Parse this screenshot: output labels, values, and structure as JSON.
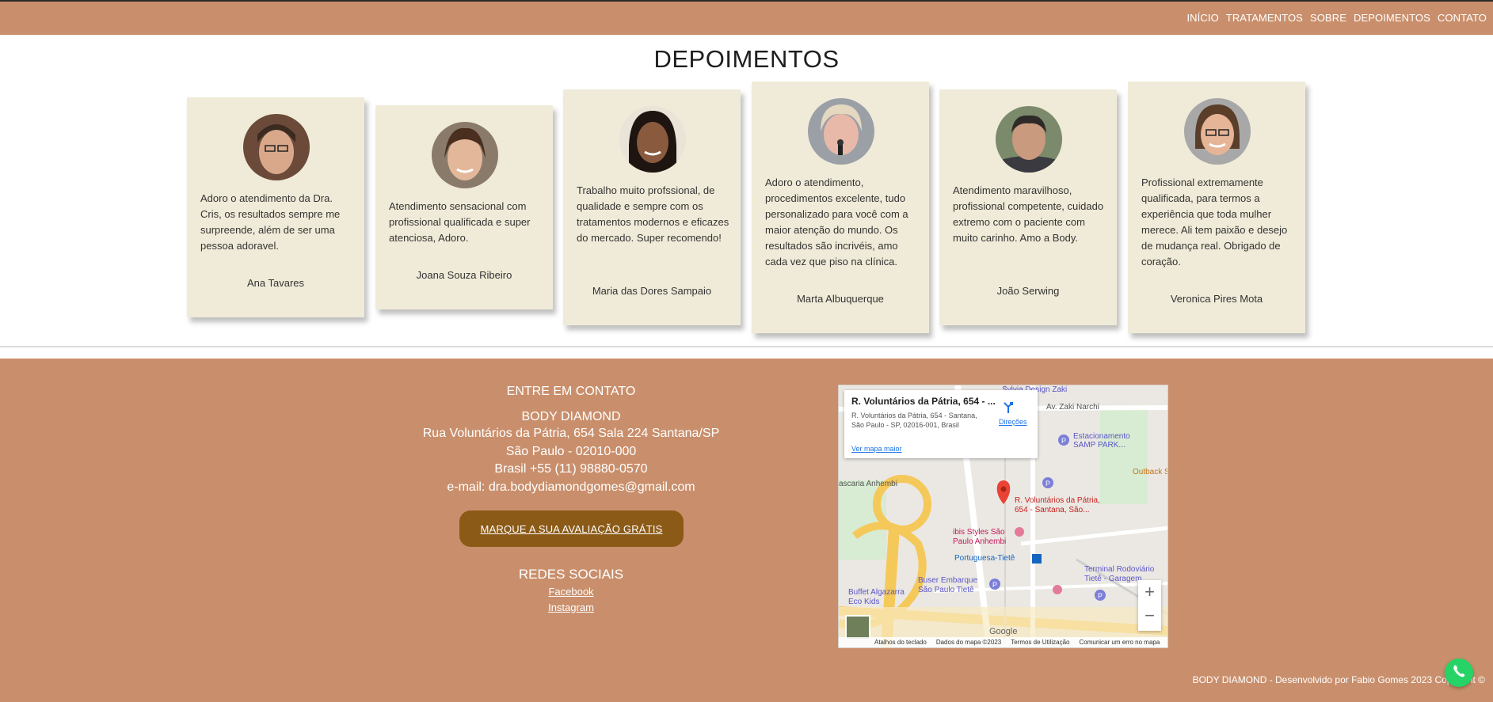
{
  "nav": {
    "items": [
      "INÍCIO",
      "TRATAMENTOS",
      "SOBRE",
      "DEPOIMENTOS",
      "CONTATO"
    ]
  },
  "testimonials": {
    "title": "DEPOIMENTOS",
    "cards": [
      {
        "quote": "Adoro o atendimento da Dra. Cris, os resultados sempre me surpreende, além de ser uma pessoa adoravel.",
        "author": "Ana Tavares"
      },
      {
        "quote": "Atendimento sensacional com profissional qualificada e super atenciosa, Adoro.",
        "author": "Joana Souza Ribeiro"
      },
      {
        "quote": "Trabalho muito profssional, de qualidade e sempre com os tratamentos modernos e eficazes do mercado. Super recomendo!",
        "author": "Maria das Dores Sampaio"
      },
      {
        "quote": "Adoro o atendimento, procedimentos excelente, tudo personalizado para você com a maior atenção do mundo. Os resultados são incrivéis, amo cada vez que piso na clínica.",
        "author": "Marta Albuquerque"
      },
      {
        "quote": "Atendimento maravilhoso, profissional competente, cuidado extremo com o paciente com muito carinho. Amo a Body.",
        "author": "João Serwing"
      },
      {
        "quote": "Profissional extremamente qualificada, para termos a experiência que toda mulher merece. Ali tem paixão e desejo de mudança real. Obrigado de coração.",
        "author": "Veronica Pires Mota"
      }
    ]
  },
  "contact": {
    "heading": "ENTRE EM CONTATO",
    "brand": "BODY DIAMOND",
    "address": "Rua Voluntários da Pátria, 654 Sala 224 Santana/SP",
    "city": "São Paulo - 02010-000",
    "phone": "Brasil +55 (11) 98880-0570",
    "email": "e-mail: dra.bodydiamondgomes@gmail.com",
    "cta": "MARQUE A SUA AVALIAÇÃO GRÁTIS",
    "social_heading": "REDES SOCIAIS",
    "facebook": "Facebook",
    "instagram": "Instagram"
  },
  "map": {
    "title": "R. Voluntários da Pátria, 654 - ...",
    "address": "R. Voluntários da Pátria, 654 - Santana, São Paulo - SP, 02016-001, Brasil",
    "directions": "Direções",
    "bigger_map": "Ver mapa maior",
    "pin_label_1": "R. Voluntários da Pátria,",
    "pin_label_2": "654 - Santana, São...",
    "labels": {
      "sylvia": "Sylvia Design Zaki",
      "zaki": "Av. Zaki Narchi",
      "estacionamento1": "Estacionamento",
      "estacionamento2": "SAMP PARK...",
      "outback": "Outback Stea",
      "anhembi": "ascaria Anhembi",
      "ibis1": "ibis Styles São",
      "ibis2": "Paulo Anhembi",
      "tiete": "Portuguesa-Tietê",
      "buser1": "Buser Embarque",
      "buser2": "São Paulo Tietê",
      "buffet1": "Buffet Algazarra",
      "buffet2": "Eco Kids",
      "terminal1": "Terminal Rodoviário",
      "terminal2": "Tietê - Garagem",
      "google": "Google"
    },
    "footer": [
      "Atalhos do teclado",
      "Dados do mapa ©2023",
      "Termos de Utilização",
      "Comunicar um erro no mapa"
    ],
    "zoom_in": "+",
    "zoom_out": "−"
  },
  "footer": {
    "copyright": "BODY DIAMOND - Desenvolvido por Fabio Gomes 2023 Copyright ©"
  },
  "colors": {
    "accent": "#c98f6c",
    "card_bg": "#f0ebd8",
    "cta_bg": "#8b5a17",
    "whatsapp": "#25d366"
  }
}
